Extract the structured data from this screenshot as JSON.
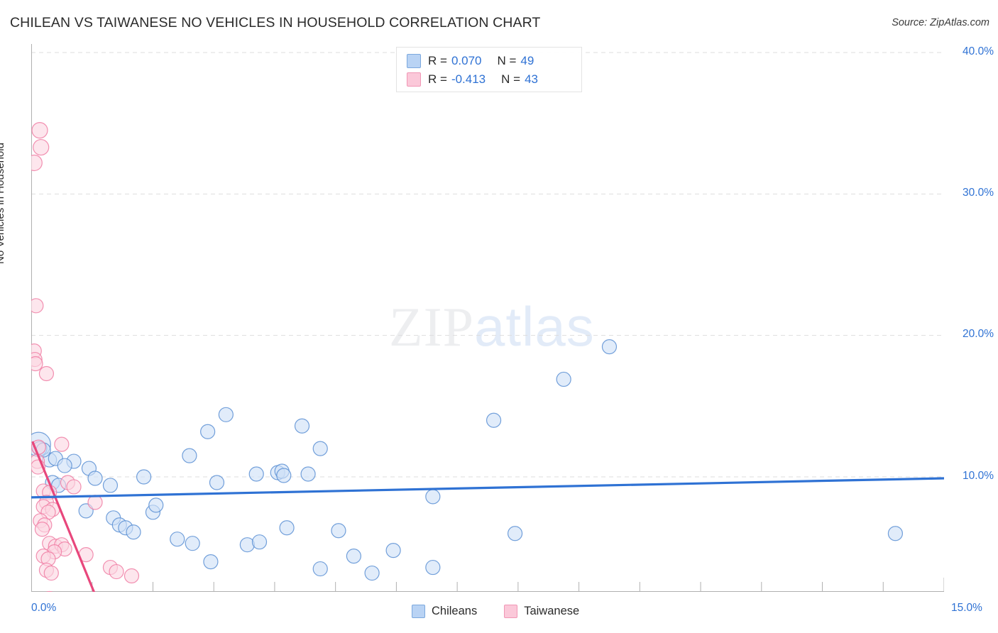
{
  "title": "CHILEAN VS TAIWANESE NO VEHICLES IN HOUSEHOLD CORRELATION CHART",
  "source": "Source: ZipAtlas.com",
  "watermark": {
    "part1": "ZIP",
    "part2": "atlas"
  },
  "axes": {
    "y_title": "No Vehicles in Household",
    "y_ticks": [
      "40.0%",
      "30.0%",
      "20.0%",
      "10.0%"
    ],
    "x_ticks": [
      "0.0%",
      "15.0%"
    ]
  },
  "correlation_legend": [
    {
      "series": "Chileans",
      "color": "#b9d3f4",
      "r_label": "R = ",
      "r_value": "0.070",
      "n_label": "N = ",
      "n_value": "49"
    },
    {
      "series": "Taiwanese",
      "color": "#fbc8d9",
      "r_label": "R = ",
      "r_value": "-0.413",
      "n_label": "N = ",
      "n_value": "43"
    }
  ],
  "series_legend": [
    {
      "label": "Chileans",
      "color": "#b9d3f4",
      "border": "#7ba8de"
    },
    {
      "label": "Taiwanese",
      "color": "#fbc8d9",
      "border": "#f196b5"
    }
  ],
  "colors": {
    "blue_fill": "#cfe0f7",
    "blue_stroke": "#5b8fd4",
    "pink_fill": "#fbd6e2",
    "pink_stroke": "#f07ca3",
    "blue_trend": "#2f72d4",
    "pink_trend": "#e8477c",
    "tick_text": "#2f72d4",
    "grid": "#dddddd",
    "axis": "#b0b0b0"
  },
  "chart_data": {
    "type": "scatter",
    "title": "CHILEAN VS TAIWANESE NO VEHICLES IN HOUSEHOLD CORRELATION CHART",
    "xlabel": "",
    "ylabel": "No Vehicles in Household",
    "xlim": [
      0,
      15
    ],
    "ylim": [
      0,
      42
    ],
    "x_unit": "%",
    "y_unit": "%",
    "grid": true,
    "legend_position": "bottom-center",
    "series": [
      {
        "name": "Chileans",
        "color": "#cfe0f7",
        "r": 0.07,
        "n": 49,
        "trendline": {
          "x0": 0.0,
          "y0": 8.55,
          "x1": 15.0,
          "y1": 9.9
        },
        "points": [
          {
            "x": 0.12,
            "y": 12.3,
            "r": 17
          },
          {
            "x": 0.14,
            "y": 12.0,
            "r": 10
          },
          {
            "x": 0.3,
            "y": 11.2,
            "r": 10
          },
          {
            "x": 0.4,
            "y": 11.3,
            "r": 10
          },
          {
            "x": 0.35,
            "y": 9.6,
            "r": 10
          },
          {
            "x": 0.45,
            "y": 9.4,
            "r": 10
          },
          {
            "x": 0.7,
            "y": 11.1,
            "r": 10
          },
          {
            "x": 0.95,
            "y": 10.6,
            "r": 10
          },
          {
            "x": 1.05,
            "y": 9.9,
            "r": 10
          },
          {
            "x": 1.3,
            "y": 9.4,
            "r": 10
          },
          {
            "x": 1.85,
            "y": 10.0,
            "r": 10
          },
          {
            "x": 0.9,
            "y": 7.6,
            "r": 10
          },
          {
            "x": 1.35,
            "y": 7.1,
            "r": 10
          },
          {
            "x": 1.45,
            "y": 6.6,
            "r": 10
          },
          {
            "x": 1.55,
            "y": 6.4,
            "r": 10
          },
          {
            "x": 1.68,
            "y": 6.1,
            "r": 10
          },
          {
            "x": 2.0,
            "y": 7.5,
            "r": 10
          },
          {
            "x": 2.05,
            "y": 8.0,
            "r": 10
          },
          {
            "x": 2.4,
            "y": 5.6,
            "r": 10
          },
          {
            "x": 2.65,
            "y": 5.3,
            "r": 10
          },
          {
            "x": 2.6,
            "y": 11.5,
            "r": 10
          },
          {
            "x": 2.9,
            "y": 13.2,
            "r": 10
          },
          {
            "x": 3.2,
            "y": 14.4,
            "r": 10
          },
          {
            "x": 3.05,
            "y": 9.6,
            "r": 10
          },
          {
            "x": 2.95,
            "y": 4.0,
            "r": 10
          },
          {
            "x": 3.55,
            "y": 5.2,
            "r": 10
          },
          {
            "x": 3.75,
            "y": 5.4,
            "r": 10
          },
          {
            "x": 3.7,
            "y": 10.2,
            "r": 10
          },
          {
            "x": 4.05,
            "y": 10.3,
            "r": 10
          },
          {
            "x": 4.12,
            "y": 10.4,
            "r": 10
          },
          {
            "x": 4.15,
            "y": 10.1,
            "r": 10
          },
          {
            "x": 4.2,
            "y": 6.4,
            "r": 10
          },
          {
            "x": 4.45,
            "y": 13.6,
            "r": 10
          },
          {
            "x": 4.55,
            "y": 10.2,
            "r": 10
          },
          {
            "x": 4.75,
            "y": 12.0,
            "r": 10
          },
          {
            "x": 4.75,
            "y": 3.5,
            "r": 10
          },
          {
            "x": 5.05,
            "y": 6.2,
            "r": 10
          },
          {
            "x": 5.3,
            "y": 4.4,
            "r": 10
          },
          {
            "x": 5.6,
            "y": 3.2,
            "r": 10
          },
          {
            "x": 5.95,
            "y": 4.8,
            "r": 10
          },
          {
            "x": 6.6,
            "y": 8.6,
            "r": 10
          },
          {
            "x": 6.6,
            "y": 3.6,
            "r": 10
          },
          {
            "x": 7.6,
            "y": 14.0,
            "r": 10
          },
          {
            "x": 7.95,
            "y": 6.0,
            "r": 10
          },
          {
            "x": 8.75,
            "y": 16.9,
            "r": 10
          },
          {
            "x": 9.5,
            "y": 19.2,
            "r": 10
          },
          {
            "x": 14.2,
            "y": 6.0,
            "r": 10
          },
          {
            "x": 0.55,
            "y": 10.8,
            "r": 10
          },
          {
            "x": 0.2,
            "y": 11.9,
            "r": 10
          }
        ]
      },
      {
        "name": "Taiwanese",
        "color": "#fbd6e2",
        "r": -0.413,
        "n": 43,
        "trendline": {
          "x0": 0.02,
          "y0": 12.5,
          "x1": 1.18,
          "y1": 0.3
        },
        "points": [
          {
            "x": 0.14,
            "y": 34.5,
            "r": 11
          },
          {
            "x": 0.16,
            "y": 33.3,
            "r": 11
          },
          {
            "x": 0.05,
            "y": 32.2,
            "r": 11
          },
          {
            "x": 0.08,
            "y": 22.1,
            "r": 10
          },
          {
            "x": 0.05,
            "y": 18.9,
            "r": 10
          },
          {
            "x": 0.06,
            "y": 18.3,
            "r": 10
          },
          {
            "x": 0.07,
            "y": 18.0,
            "r": 10
          },
          {
            "x": 0.25,
            "y": 17.3,
            "r": 10
          },
          {
            "x": 0.5,
            "y": 12.3,
            "r": 10
          },
          {
            "x": 0.12,
            "y": 12.1,
            "r": 10
          },
          {
            "x": 0.1,
            "y": 11.1,
            "r": 10
          },
          {
            "x": 0.11,
            "y": 10.7,
            "r": 10
          },
          {
            "x": 0.6,
            "y": 9.6,
            "r": 10
          },
          {
            "x": 0.7,
            "y": 9.3,
            "r": 10
          },
          {
            "x": 0.2,
            "y": 9.0,
            "r": 10
          },
          {
            "x": 0.3,
            "y": 8.9,
            "r": 10
          },
          {
            "x": 0.25,
            "y": 8.2,
            "r": 10
          },
          {
            "x": 0.2,
            "y": 7.9,
            "r": 10
          },
          {
            "x": 0.35,
            "y": 7.7,
            "r": 10
          },
          {
            "x": 0.28,
            "y": 7.5,
            "r": 10
          },
          {
            "x": 1.05,
            "y": 8.2,
            "r": 10
          },
          {
            "x": 0.15,
            "y": 6.9,
            "r": 10
          },
          {
            "x": 0.22,
            "y": 6.6,
            "r": 10
          },
          {
            "x": 0.18,
            "y": 6.3,
            "r": 10
          },
          {
            "x": 0.3,
            "y": 5.3,
            "r": 10
          },
          {
            "x": 0.4,
            "y": 5.1,
            "r": 10
          },
          {
            "x": 0.5,
            "y": 5.2,
            "r": 10
          },
          {
            "x": 0.55,
            "y": 4.9,
            "r": 10
          },
          {
            "x": 0.38,
            "y": 4.7,
            "r": 10
          },
          {
            "x": 0.2,
            "y": 4.4,
            "r": 10
          },
          {
            "x": 0.28,
            "y": 4.2,
            "r": 10
          },
          {
            "x": 0.9,
            "y": 4.5,
            "r": 10
          },
          {
            "x": 0.25,
            "y": 3.4,
            "r": 10
          },
          {
            "x": 0.33,
            "y": 3.2,
            "r": 10
          },
          {
            "x": 1.3,
            "y": 3.6,
            "r": 10
          },
          {
            "x": 1.4,
            "y": 3.3,
            "r": 10
          },
          {
            "x": 1.65,
            "y": 3.0,
            "r": 10
          },
          {
            "x": 0.3,
            "y": 1.4,
            "r": 10
          },
          {
            "x": 0.45,
            "y": 1.3,
            "r": 10
          },
          {
            "x": 0.55,
            "y": 1.2,
            "r": 10
          },
          {
            "x": 0.62,
            "y": 1.0,
            "r": 10
          },
          {
            "x": 0.35,
            "y": 0.9,
            "r": 10
          },
          {
            "x": 0.48,
            "y": 0.7,
            "r": 10
          }
        ]
      }
    ]
  }
}
